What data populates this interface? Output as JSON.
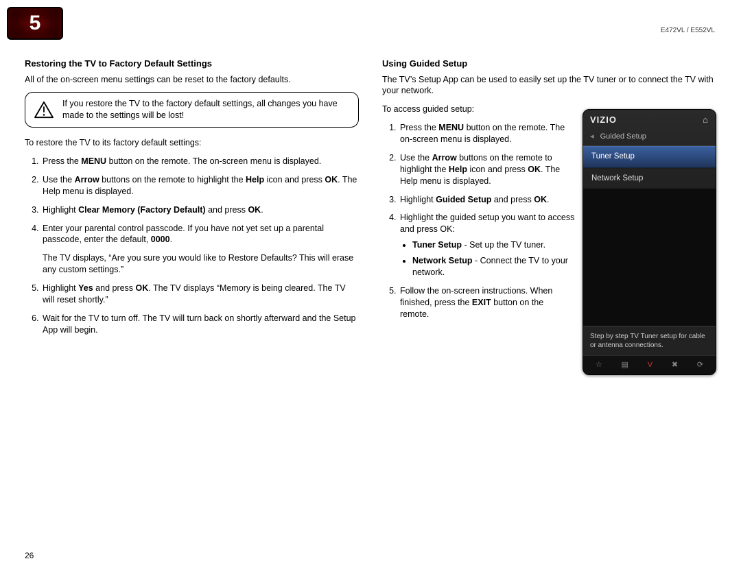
{
  "chapter_number": "5",
  "model_label": "E472VL / E552VL",
  "page_number": "26",
  "left": {
    "heading": "Restoring the TV to Factory Default Settings",
    "intro": "All of the on-screen menu settings can be reset to the factory defaults.",
    "warning": "If you restore the TV to the factory default settings, all changes you have made to the settings will be lost!",
    "lead": "To restore the TV to its factory default settings:",
    "steps_html": {
      "s1": "Press the <b>MENU</b> button on the remote. The on-screen menu is displayed.",
      "s2": "Use the <b>Arrow</b> buttons on the remote to highlight the <b>Help</b> icon and press <b>OK</b>. The Help menu is displayed.",
      "s3": "Highlight <b>Clear Memory (Factory Default)</b> and press <b>OK</b>.",
      "s4a": "Enter your parental control passcode. If you have not yet set up a parental passcode, enter the default, <b>0000</b>.",
      "s4b": "The TV displays, “Are you sure you would like to Restore Defaults? This will erase any custom settings.”",
      "s5": "Highlight <b>Yes</b> and press <b>OK</b>. The TV displays “Memory is being cleared. The TV will reset shortly.”",
      "s6": "Wait for the TV to turn off. The TV will turn back on shortly afterward and the Setup App will begin."
    }
  },
  "right": {
    "heading": "Using Guided Setup",
    "intro": "The TV’s Setup App can be used to easily set up the TV tuner or to connect the TV with your network.",
    "lead": "To access guided setup:",
    "steps_html": {
      "s1": "Press the <b>MENU</b> button on the remote. The on-screen menu is displayed.",
      "s2": "Use the <b>Arrow</b> buttons on the remote to highlight the <b>Help</b> icon and press <b>OK</b>. The Help menu is displayed.",
      "s3": "Highlight <b>Guided Setup</b> and press <b>OK</b>.",
      "s4": "Highlight the guided setup you want to access and press OK:",
      "s4_b1": "<b>Tuner Setup</b> - Set up the TV tuner.",
      "s4_b2": "<b>Network Setup</b> - Connect the TV to your network.",
      "s5": "Follow the on-screen instructions. When finished, press the <b>EXIT</b> button on the remote."
    }
  },
  "tv_menu": {
    "brand": "VIZIO",
    "breadcrumb": "Guided Setup",
    "item_selected": "Tuner Setup",
    "item_2": "Network Setup",
    "help_text": "Step by step TV Tuner setup for cable or antenna connections.",
    "footer_icons": [
      "☆",
      "▤",
      "V",
      "✖",
      "⟳"
    ]
  }
}
